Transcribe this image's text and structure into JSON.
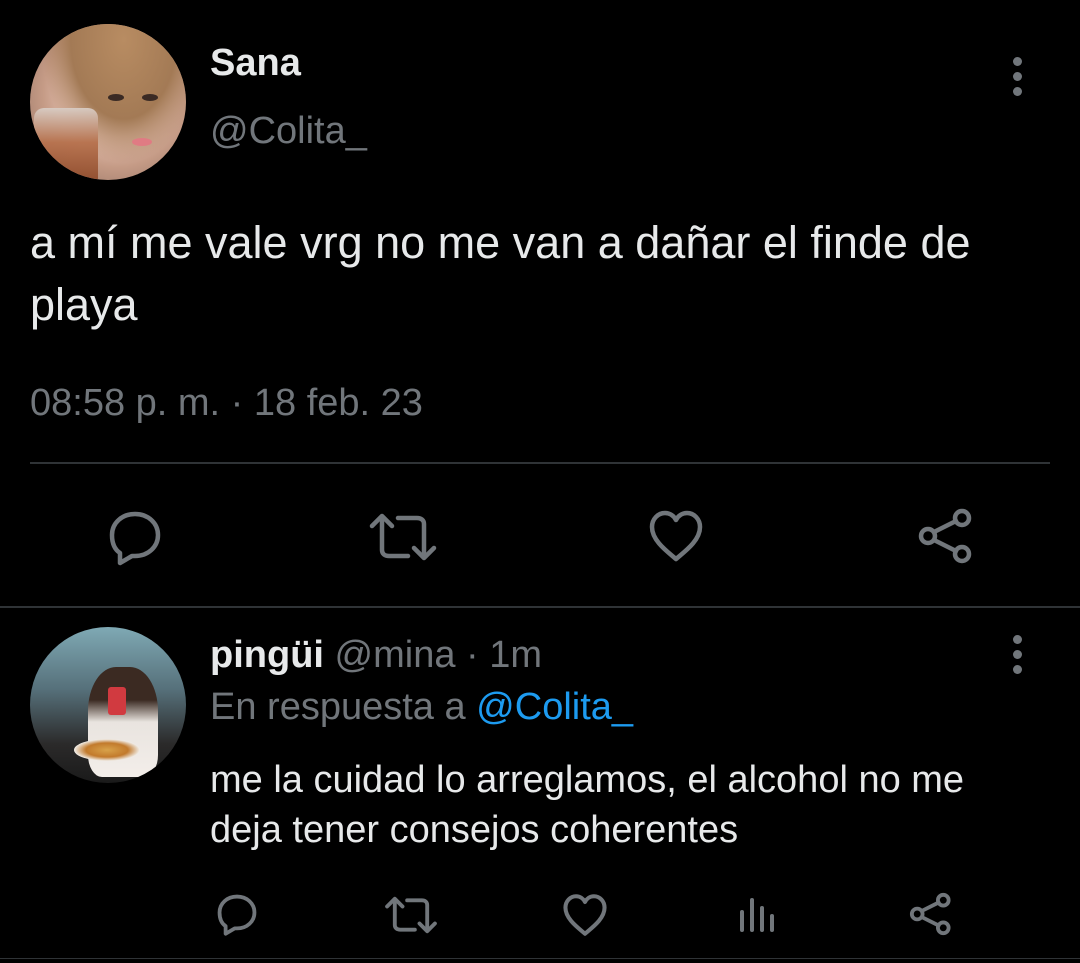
{
  "main_tweet": {
    "author_name": "Sana",
    "author_handle": "@Colita_",
    "text": "a mí me vale vrg no me van a dañar el finde de playa",
    "timestamp": "08:58 p. m. · 18 feb. 23",
    "actions": [
      "reply-icon",
      "retweet-icon",
      "like-icon",
      "share-icon"
    ]
  },
  "reply_tweet": {
    "author_name": "pingüi",
    "author_handle": "@mina",
    "time_ago": "· 1m",
    "reply_prefix": "En respuesta a",
    "reply_to_handle": "@Colita_",
    "text": "me la cuidad lo arreglamos, el alcohol no me deja tener consejos coherentes",
    "actions": [
      "reply-icon",
      "retweet-icon",
      "like-icon",
      "views-icon",
      "share-icon"
    ]
  },
  "colors": {
    "background": "#000000",
    "text_primary": "#e7e9ea",
    "text_secondary": "#71767b",
    "link": "#1d9bf0",
    "divider": "#2f3336"
  }
}
